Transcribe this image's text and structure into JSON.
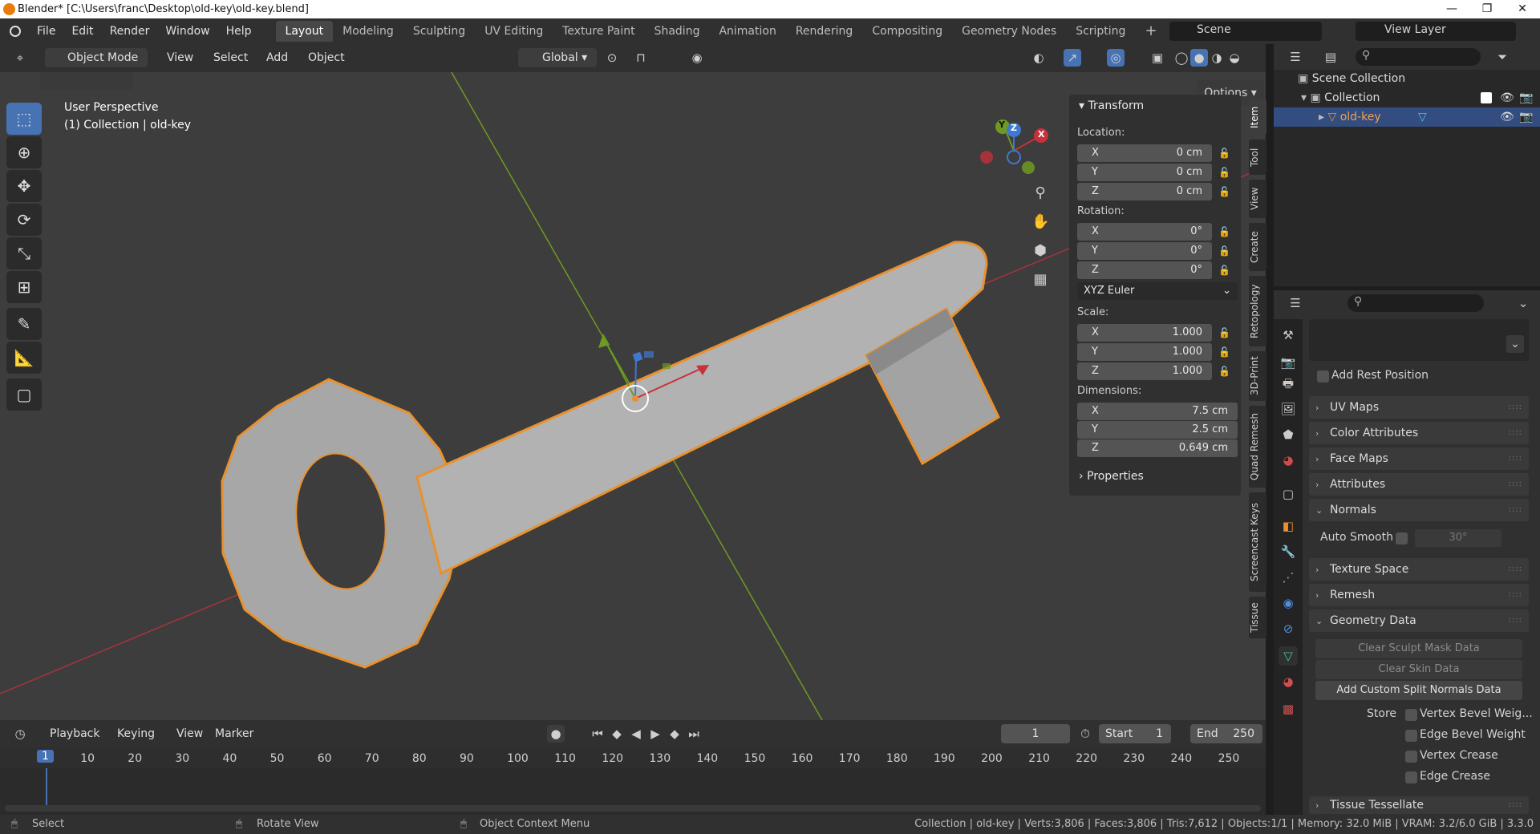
{
  "window": {
    "title": "Blender* [C:\\Users\\franc\\Desktop\\old-key\\old-key.blend]",
    "controls": [
      "—",
      "❐",
      "✕"
    ]
  },
  "menus": [
    "File",
    "Edit",
    "Render",
    "Window",
    "Help"
  ],
  "workspaces": [
    "Layout",
    "Modeling",
    "Sculpting",
    "UV Editing",
    "Texture Paint",
    "Shading",
    "Animation",
    "Rendering",
    "Compositing",
    "Geometry Nodes",
    "Scripting"
  ],
  "active_workspace": "Layout",
  "scene": {
    "label": "Scene",
    "view_layer": "View Layer"
  },
  "viewport_header": {
    "mode": "Object Mode",
    "menus": [
      "View",
      "Select",
      "Add",
      "Object"
    ],
    "orientation": "Global",
    "options": "Options"
  },
  "viewport": {
    "perspective": "User Perspective",
    "collection_info": "(1) Collection | old-key"
  },
  "gizmo": {
    "x": "X",
    "y": "Y",
    "z": "Z"
  },
  "npanel": {
    "transform_title": "Transform",
    "location_label": "Location:",
    "location": [
      {
        "axis": "X",
        "value": "0 cm"
      },
      {
        "axis": "Y",
        "value": "0 cm"
      },
      {
        "axis": "Z",
        "value": "0 cm"
      }
    ],
    "rotation_label": "Rotation:",
    "rotation": [
      {
        "axis": "X",
        "value": "0°"
      },
      {
        "axis": "Y",
        "value": "0°"
      },
      {
        "axis": "Z",
        "value": "0°"
      }
    ],
    "rotation_mode": "XYZ Euler",
    "scale_label": "Scale:",
    "scale": [
      {
        "axis": "X",
        "value": "1.000"
      },
      {
        "axis": "Y",
        "value": "1.000"
      },
      {
        "axis": "Z",
        "value": "1.000"
      }
    ],
    "dimensions_label": "Dimensions:",
    "dimensions": [
      {
        "axis": "X",
        "value": "7.5 cm"
      },
      {
        "axis": "Y",
        "value": "2.5 cm"
      },
      {
        "axis": "Z",
        "value": "0.649 cm"
      }
    ],
    "properties_title": "Properties"
  },
  "side_tabs": [
    "Item",
    "Tool",
    "View",
    "Create",
    "Retopology",
    "3D-Print",
    "Quad Remesh",
    "Screencast Keys",
    "Tissue"
  ],
  "outliner": {
    "scene_collection": "Scene Collection",
    "collection": "Collection",
    "object": "old-key"
  },
  "properties": {
    "add_rest_position": "Add Rest Position",
    "sections": [
      "UV Maps",
      "Color Attributes",
      "Face Maps",
      "Attributes",
      "Normals",
      "Texture Space",
      "Remesh",
      "Geometry Data",
      "Tissue Tessellate"
    ],
    "auto_smooth": "Auto Smooth",
    "auto_smooth_angle": "30°",
    "clear_sculpt": "Clear Sculpt Mask Data",
    "clear_skin": "Clear Skin Data",
    "add_custom_split": "Add Custom Split Normals Data",
    "store_label": "Store",
    "store_options": [
      "Vertex Bevel Weig...",
      "Edge Bevel Weight",
      "Vertex Crease",
      "Edge Crease"
    ]
  },
  "timeline": {
    "menus": [
      "Playback",
      "Keying",
      "View",
      "Marker"
    ],
    "current_frame": "1",
    "start_label": "Start",
    "start": "1",
    "end_label": "End",
    "end": "250",
    "ticks": [
      "1",
      "10",
      "20",
      "30",
      "40",
      "50",
      "60",
      "70",
      "80",
      "90",
      "100",
      "110",
      "120",
      "130",
      "140",
      "150",
      "160",
      "170",
      "180",
      "190",
      "200",
      "210",
      "220",
      "230",
      "240",
      "250"
    ]
  },
  "status": {
    "select": "Select",
    "rotate": "Rotate View",
    "context": "Object Context Menu",
    "stats": "Collection | old-key | Verts:3,806 | Faces:3,806 | Tris:7,612 | Objects:1/1 | Memory: 32.0 MiB | VRAM: 3.2/6.0 GiB | 3.3.0"
  },
  "colors": {
    "accent": "#4772b3",
    "selection": "#e8912e",
    "x_axis": "#c8303a",
    "y_axis": "#6a9a1c",
    "z_axis": "#3e78d0"
  }
}
